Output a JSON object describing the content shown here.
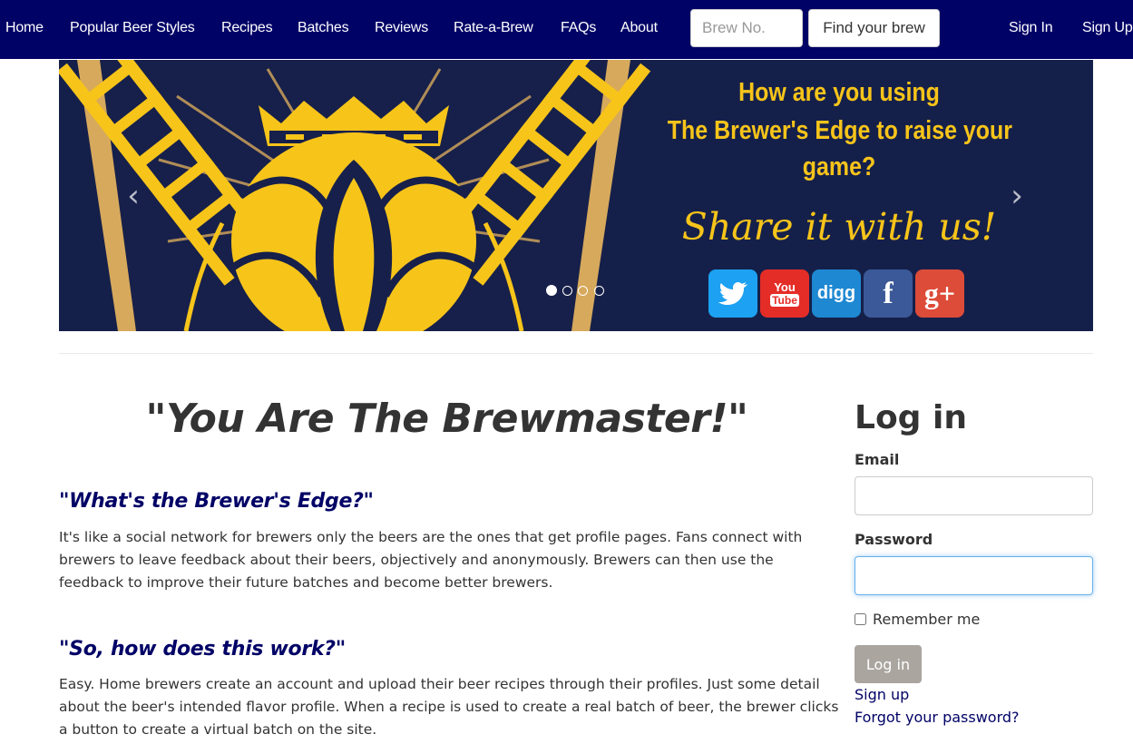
{
  "nav": {
    "items": [
      {
        "label": "Home"
      },
      {
        "label": "Popular Beer Styles"
      },
      {
        "label": "Recipes"
      },
      {
        "label": "Batches"
      },
      {
        "label": "Reviews"
      },
      {
        "label": "Rate-a-Brew"
      },
      {
        "label": "FAQs"
      },
      {
        "label": "About"
      }
    ],
    "brew_placeholder": "Brew No.",
    "find_label": "Find your brew",
    "sign_in": "Sign In",
    "sign_up": "Sign Up"
  },
  "carousel": {
    "line1": "How are you using",
    "line2": "The Brewer's Edge to raise your",
    "line3": "game?",
    "script": "Share it with us!",
    "prev_icon": "chevron-left-icon",
    "next_icon": "chevron-right-icon",
    "slide_count": 4,
    "active_slide": 1,
    "social": {
      "twitter": "twitter-icon",
      "youtube_top": "You",
      "youtube_bottom": "Tube",
      "digg": "digg",
      "facebook": "f",
      "gplus": "g+"
    },
    "colors": {
      "background": "#15204a",
      "gold": "#f7c41a"
    }
  },
  "main": {
    "title": "\"You Are The Brewmaster!\"",
    "q1": "\"What's the Brewer's Edge?\"",
    "p1": "It's like a social network for brewers only the beers are the ones that get profile pages. Fans connect with brewers to leave feedback about their beers, objectively and anonymously. Brewers can then use the feedback to improve their future batches and become better brewers.",
    "q2": "\"So, how does this work?\"",
    "p2": "Easy. Home brewers create an account and upload their beer recipes through their profiles. Just some detail about the beer's intended flavor profile. When a recipe is used to create a real batch of beer, the brewer clicks a button to create a virtual batch on the site."
  },
  "login": {
    "title": "Log in",
    "email_label": "Email",
    "password_label": "Password",
    "remember_label": "Remember me",
    "button": "Log in",
    "signup_link": "Sign up",
    "forgot_link": "Forgot your password?"
  },
  "colors": {
    "nav_bg": "#010266",
    "link": "#010266",
    "button_bg": "#aaa59f"
  }
}
